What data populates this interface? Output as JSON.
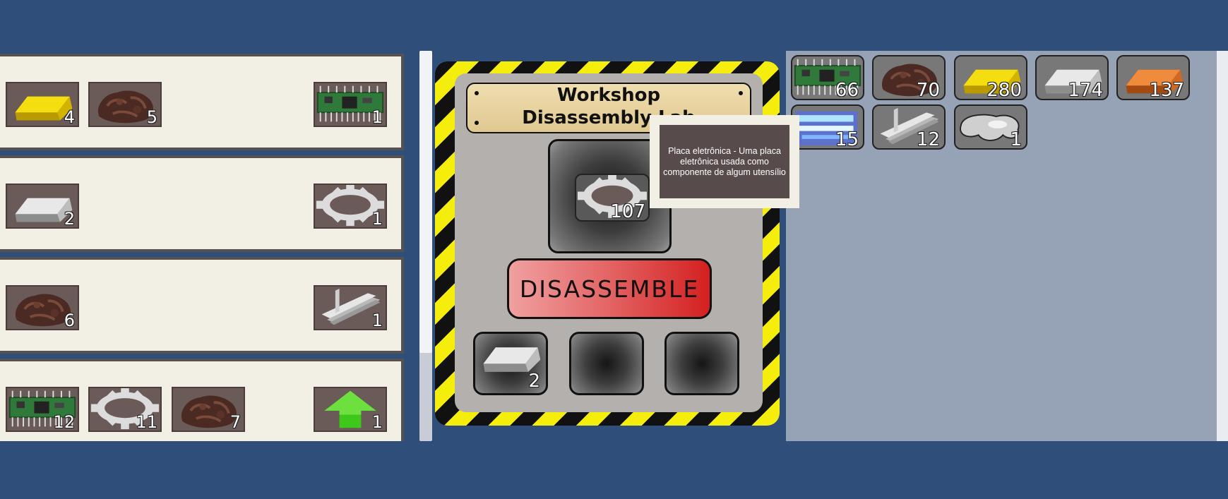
{
  "recipes": [
    {
      "ingredients": [
        {
          "icon": "gold-bar-icon",
          "qty": "4"
        },
        {
          "icon": "rock-ore-icon",
          "qty": "5"
        }
      ],
      "result": {
        "icon": "circuit-board-icon",
        "qty": "1"
      }
    },
    {
      "ingredients": [
        {
          "icon": "silver-bar-icon",
          "qty": "2"
        }
      ],
      "result": {
        "icon": "gear-icon",
        "qty": "1"
      }
    },
    {
      "ingredients": [
        {
          "icon": "rock-ore-icon",
          "qty": "6"
        }
      ],
      "result": {
        "icon": "steel-beam-icon",
        "qty": "1"
      }
    },
    {
      "ingredients": [
        {
          "icon": "circuit-board-icon",
          "qty": "12"
        },
        {
          "icon": "gear-icon",
          "qty": "11"
        },
        {
          "icon": "rock-ore-icon",
          "qty": "7"
        }
      ],
      "result": {
        "icon": "green-up-arrow-icon",
        "qty": "1"
      }
    }
  ],
  "workshop": {
    "title_line1": "Workshop",
    "title_line2": "Disassembly Lab",
    "input": {
      "icon": "gear-icon",
      "qty": "107"
    },
    "button_label": "DISASSEMBLE",
    "outputs": [
      {
        "icon": "silver-bar-icon",
        "qty": "2"
      },
      {
        "icon": "",
        "qty": ""
      },
      {
        "icon": "",
        "qty": ""
      }
    ]
  },
  "tooltip": {
    "text": "Placa eletrônica - Uma placa eletrônica usada como componente de algum utensílio"
  },
  "inventory": [
    {
      "icon": "circuit-board-icon",
      "qty": "66"
    },
    {
      "icon": "rock-ore-icon",
      "qty": "70"
    },
    {
      "icon": "gold-bar-icon",
      "qty": "280"
    },
    {
      "icon": "silver-bar-icon",
      "qty": "174"
    },
    {
      "icon": "copper-bar-icon",
      "qty": "137"
    },
    {
      "icon": "blue-crystal-icon",
      "qty": "15"
    },
    {
      "icon": "steel-beam-icon",
      "qty": "12"
    },
    {
      "icon": "liquid-metal-icon",
      "qty": "1"
    }
  ],
  "colors": {
    "background": "#2f4e7a",
    "button_red": "#d42020",
    "hazard_yellow": "#f5ee0c"
  }
}
